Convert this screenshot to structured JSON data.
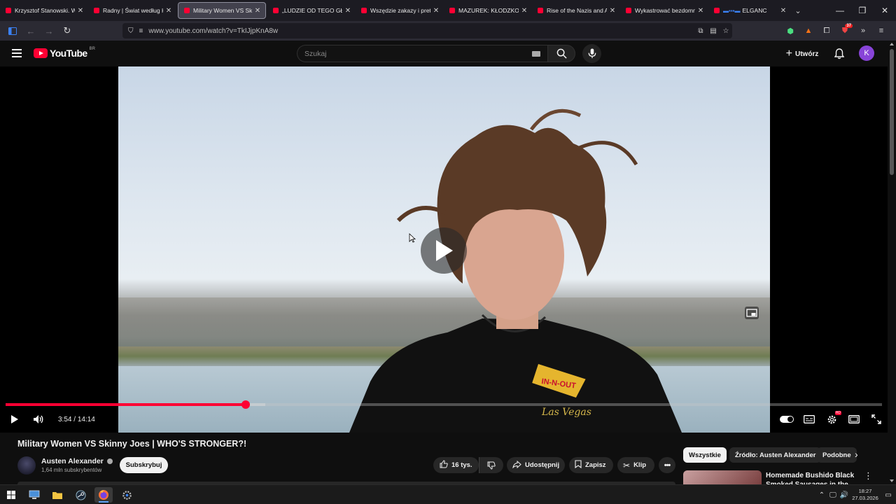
{
  "browser": {
    "tabs": [
      {
        "title": "Krzysztof Stanowski. W ją",
        "active": false
      },
      {
        "title": "Radny | Świat według Kie",
        "active": false
      },
      {
        "title": "Military Women VS Skinn",
        "active": true
      },
      {
        "title": "„LUDZIE OD TEGO GŁUPI",
        "active": false
      },
      {
        "title": "Wszędzie zakazy i preten",
        "active": false
      },
      {
        "title": "MAZUREK: KŁODZKO, PE",
        "active": false
      },
      {
        "title": "Rise of the Nazis and Ad",
        "active": false
      },
      {
        "title": "Wykastrować bezdomno",
        "active": false
      },
      {
        "title": "ELGANC",
        "active": false
      }
    ],
    "url": "www.youtube.com/watch?v=TkIJjpKnA8w",
    "ext_badge": "37"
  },
  "youtube": {
    "logo_text": "YouTube",
    "country_code": "BR",
    "search_placeholder": "Szukaj",
    "create_label": "Utwórz",
    "avatar_letter": "K"
  },
  "player": {
    "current_time": "3:54",
    "duration": "14:14",
    "progress_fraction": 0.274,
    "buffered_fraction": 0.296
  },
  "video": {
    "title": "Military Women VS Skinny Joes | WHO'S STRONGER?!",
    "channel": "Austen Alexander",
    "subscribers": "1,64 mln subskrybentów",
    "subscribe_label": "Subskrybuj",
    "likes": "16 tys.",
    "share_label": "Udostępnij",
    "save_label": "Zapisz",
    "clip_label": "Klip"
  },
  "sidebar": {
    "chips": [
      "Wszystkie",
      "Źródło: Austen Alexander",
      "Podobne"
    ],
    "rec_title": "Homemade Bushido Black Smoked Sausages in the"
  },
  "taskbar": {
    "time": "18:27",
    "date": "27.03.2026"
  },
  "colors": {
    "accent": "#ff0033",
    "background": "#0f0f0f",
    "pill": "#272727"
  }
}
